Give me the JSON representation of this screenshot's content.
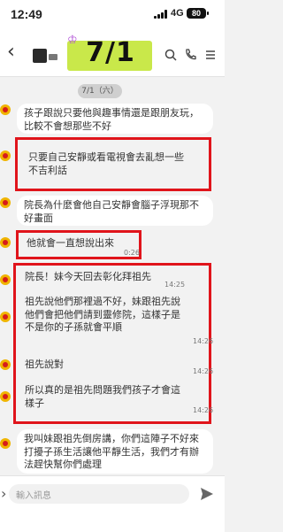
{
  "status": {
    "time": "12:49",
    "network": "4G",
    "battery": "80"
  },
  "header": {
    "sticker_text": "7/1"
  },
  "date_label": "7/1（六）",
  "messages": [
    {
      "text": "孩子跟說只要他與趣事情還是跟朋友玩，比較不會想那些不好",
      "time": ""
    },
    {
      "text": "只要自己安靜或看電視會去亂想一些不吉利話",
      "time": ""
    },
    {
      "text": "院長為什麼會他自己安靜會腦子浮現那不好畫面",
      "time": ""
    },
    {
      "text": "他就會一直想說出來",
      "time": "0:26"
    },
    {
      "text": "院長！妹今天回去彰化拜祖先",
      "time": "14:25"
    },
    {
      "text": "祖先說他們那裡過不好，妹跟祖先說他們會把他們請到靈修院，這樣子是不是你的子孫就會平順",
      "time": "14:26"
    },
    {
      "text": "祖先說對",
      "time": "14:26"
    },
    {
      "text": "所以真的是祖先問題我們孩子才會這樣子",
      "time": "14:26"
    },
    {
      "text": "我叫妹跟祖先倒房講，你們這陣子不好來打擾子孫生活讓他平靜生活，我們才有辦法趕快幫你們處理",
      "time": ""
    }
  ],
  "composer": {
    "placeholder": "輸入訊息"
  }
}
